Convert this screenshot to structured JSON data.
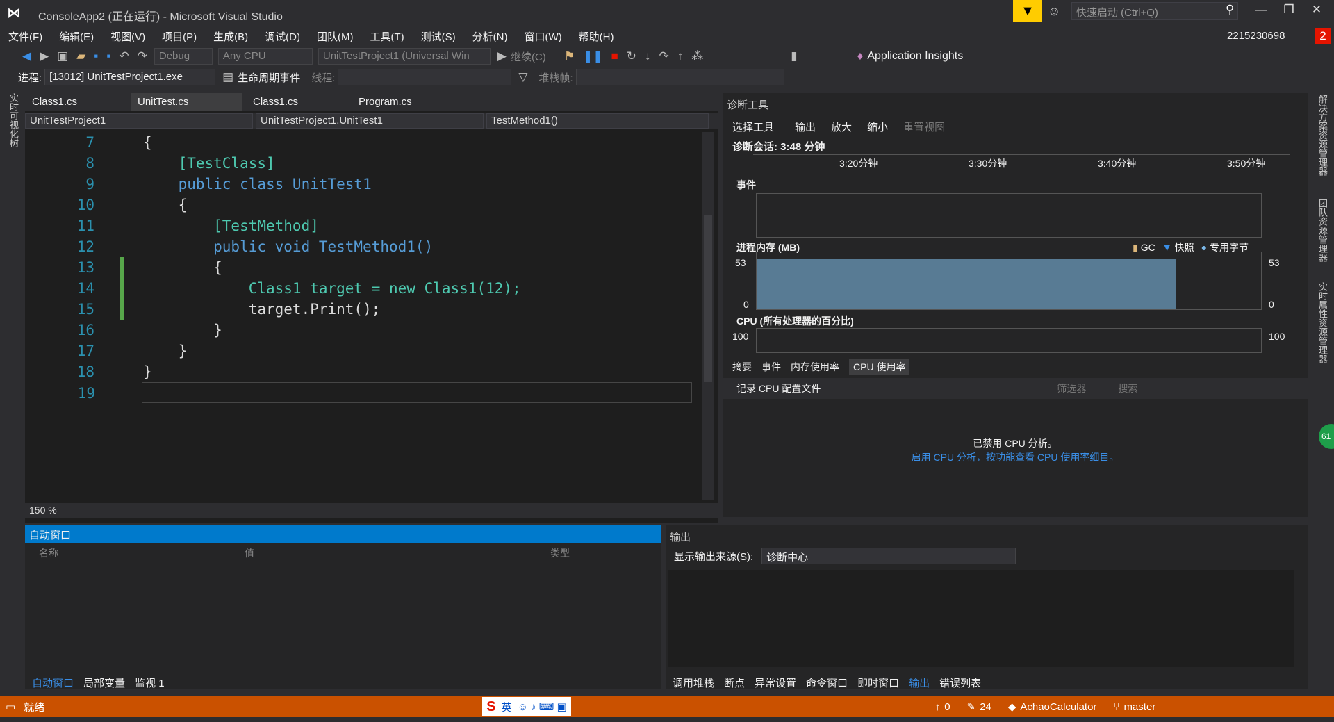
{
  "title": {
    "window_title": "ConsoleApp2 (正在运行) - Microsoft Visual Studio",
    "quick_launch_placeholder": "快速启动 (Ctrl+Q)",
    "user": "2215230698",
    "notification_count": "2"
  },
  "menu": [
    "文件(F)",
    "编辑(E)",
    "视图(V)",
    "项目(P)",
    "生成(B)",
    "调试(D)",
    "团队(M)",
    "工具(T)",
    "测试(S)",
    "分析(N)",
    "窗口(W)",
    "帮助(H)"
  ],
  "toolbar": {
    "config": "Debug",
    "platform": "Any CPU",
    "startup": "UnitTestProject1 (Universal Win",
    "continue": "继续(C)",
    "app_insights": "Application Insights"
  },
  "debugbar": {
    "process_label": "进程:",
    "process_value": "[13012] UnitTestProject1.exe",
    "lifecycle": "生命周期事件",
    "thread_label": "线程:",
    "stackframe_label": "堆栈帧:"
  },
  "left_strip": "实时可视化树",
  "editor": {
    "tabs": [
      "Class1.cs",
      "UnitTest.cs",
      "Class1.cs",
      "Program.cs"
    ],
    "nav_project": "UnitTestProject1",
    "nav_class": "UnitTestProject1.UnitTest1",
    "nav_member": "TestMethod1()",
    "zoom": "150 %",
    "lines": [
      {
        "n": "7",
        "t": "{"
      },
      {
        "n": "8",
        "t": "    [TestClass]"
      },
      {
        "n": "9",
        "t": "    public class UnitTest1"
      },
      {
        "n": "10",
        "t": "    {"
      },
      {
        "n": "11",
        "t": "        [TestMethod]"
      },
      {
        "n": "12",
        "t": "        public void TestMethod1()"
      },
      {
        "n": "13",
        "t": "        {"
      },
      {
        "n": "14",
        "t": "            Class1 target = new Class1(12);"
      },
      {
        "n": "15",
        "t": "            target.Print();"
      },
      {
        "n": "16",
        "t": "        }"
      },
      {
        "n": "17",
        "t": "    }"
      },
      {
        "n": "18",
        "t": "}"
      },
      {
        "n": "19",
        "t": ""
      }
    ]
  },
  "diag": {
    "title": "诊断工具",
    "select_tools": "选择工具",
    "output": "输出",
    "zoom_in": "放大",
    "zoom_out": "缩小",
    "reset_view": "重置视图",
    "session": "诊断会话: 3:48 分钟",
    "ticks": [
      "3:20分钟",
      "3:30分钟",
      "3:40分钟",
      "3:50分钟"
    ],
    "events": "事件",
    "memory": "进程内存 (MB)",
    "legend": [
      "GC",
      "快照",
      "专用字节"
    ],
    "mem_max": "53",
    "mem_min": "0",
    "cpu": "CPU (所有处理器的百分比)",
    "cpu_max": "100",
    "tabs": [
      "摘要",
      "事件",
      "内存使用率",
      "CPU 使用率"
    ],
    "record": "记录 CPU 配置文件",
    "filter": "筛选器",
    "search": "搜索",
    "disabled": "已禁用 CPU 分析。",
    "enable_link": "启用 CPU 分析，按功能查看 CPU 使用率细目。"
  },
  "autos": {
    "title": "自动窗口",
    "cols": [
      "名称",
      "值",
      "类型"
    ],
    "tabs": [
      "自动窗口",
      "局部变量",
      "监视 1"
    ]
  },
  "output": {
    "title": "输出",
    "source_label": "显示输出来源(S):",
    "source_value": "诊断中心",
    "tabs": [
      "调用堆栈",
      "断点",
      "异常设置",
      "命令窗口",
      "即时窗口",
      "输出",
      "错误列表"
    ]
  },
  "right_strip": [
    "解决方案资源管理器",
    "团队资源管理器",
    "实时属性资源管理器"
  ],
  "status": {
    "ready": "就绪",
    "ime": "英",
    "up": "0",
    "edits": "24",
    "repo": "AchaoCalculator",
    "branch": "master",
    "badge": "61"
  },
  "colors": {
    "accent": "#007acc",
    "status": "#ca5100",
    "notif": "#ffcc00"
  }
}
